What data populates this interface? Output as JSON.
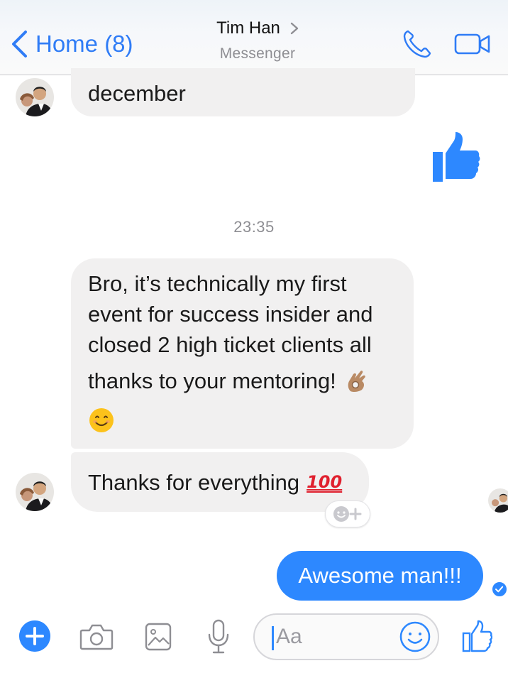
{
  "header": {
    "back_label": "Home (8)",
    "title": "Tim Han",
    "subtitle": "Messenger"
  },
  "messages": [
    {
      "direction": "incoming",
      "text": "december"
    },
    {
      "direction": "outgoing",
      "type": "thumbs-up-sticker"
    },
    {
      "type": "timestamp",
      "text": "23:35"
    },
    {
      "direction": "incoming",
      "lines": [
        "Bro, it’s technically my first",
        "event for success insider and",
        "closed 2 high ticket clients all",
        "thanks to your mentoring!"
      ],
      "emoji": [
        "ok-hand",
        "smiling-face"
      ]
    },
    {
      "direction": "incoming",
      "text": "Thanks for everything",
      "emoji": "hundred-points",
      "emoji_text": "100"
    },
    {
      "direction": "outgoing",
      "text": "Awesome man!!!",
      "status": "delivered"
    }
  ],
  "composer": {
    "placeholder": "Aa"
  },
  "colors": {
    "accent": "#2d88ff",
    "incoming_bubble": "#f1f0f0",
    "nav_link": "#2f7cf6"
  },
  "icons": [
    "chevron-left-icon",
    "chevron-right-icon",
    "phone-icon",
    "video-camera-icon",
    "thumbs-up-icon",
    "plus-icon",
    "camera-icon",
    "image-icon",
    "microphone-icon",
    "emoji-icon",
    "add-reaction-icon",
    "check-icon"
  ]
}
